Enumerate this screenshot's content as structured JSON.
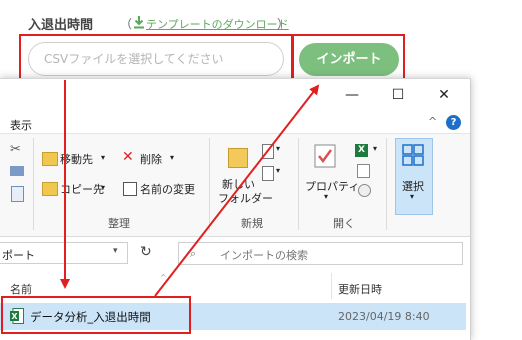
{
  "form": {
    "label": "入退出時間",
    "paren_open": "（",
    "template_link": "テンプレートのダウンロード",
    "paren_close": "）",
    "csv_placeholder": "CSVファイルを選択してください",
    "import_button": "インポート"
  },
  "window": {
    "minimize": "—",
    "maximize": "☐",
    "close": "✕",
    "ribbon_tab": "表示",
    "collapse": "^",
    "help": "?"
  },
  "ribbon": {
    "move_to": "移動先",
    "copy_to": "コピー先",
    "delete": "削除",
    "rename": "名前の変更",
    "group_organize": "整理",
    "new_folder_line1": "新しい",
    "new_folder_line2": "フォルダー",
    "group_new": "新規",
    "properties": "プロパティ",
    "group_open": "開く",
    "select": "選択"
  },
  "address": {
    "path": "ポート",
    "refresh": "↻",
    "search_placeholder": "インポートの検索"
  },
  "columns": {
    "name": "名前",
    "modified": "更新日時"
  },
  "file": {
    "name": "データ分析_入退出時間",
    "modified": "2023/04/19 8:40"
  },
  "colors": {
    "accent_green": "#7dbf7e",
    "highlight_red": "#e02020",
    "selection_blue": "#cce4f7"
  }
}
